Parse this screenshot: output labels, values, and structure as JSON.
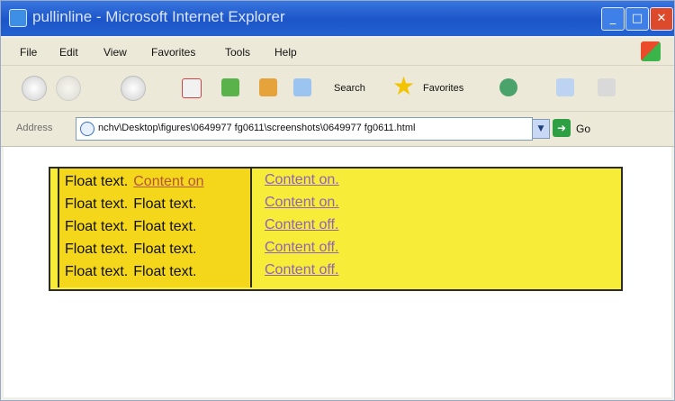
{
  "window": {
    "title": "pullinline - Microsoft Internet Explorer",
    "minimize": "_",
    "maximize": "□",
    "close": "✕"
  },
  "menu": [
    "File",
    "Edit",
    "View",
    "Favorites",
    "Tools",
    "Help"
  ],
  "toolbar": {
    "search_label": "Search",
    "favorites_label": "Favorites"
  },
  "address": {
    "label": "Address",
    "value": "nchv\\Desktop\\figures\\0649977 fg0611\\screenshots\\0649977 fg0611.html",
    "go_label": "Go"
  },
  "demo": {
    "float_rows": [
      [
        "Float text.",
        "Content on"
      ],
      [
        "Float text.",
        "Float text."
      ],
      [
        "Float text.",
        "Float text."
      ],
      [
        "Float text.",
        "Float text."
      ],
      [
        "Float text.",
        "Float text."
      ]
    ],
    "content_links": [
      "Content on.",
      "Content on.",
      "Content off.",
      "Content off.",
      "Content off."
    ]
  }
}
